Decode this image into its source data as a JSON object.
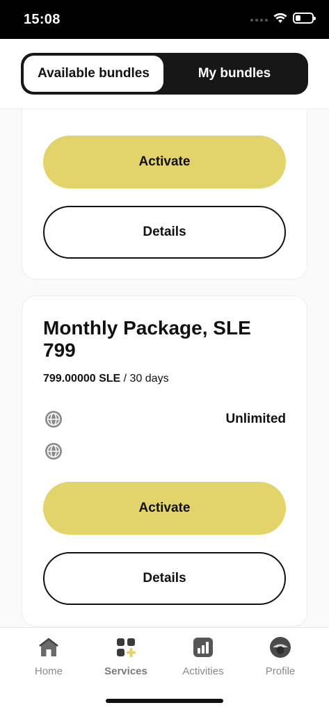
{
  "status_bar": {
    "time": "15:08"
  },
  "tabs": [
    {
      "label": "Available bundles",
      "active": true
    },
    {
      "label": "My bundles",
      "active": false
    }
  ],
  "bundles": [
    {
      "activate_label": "Activate",
      "details_label": "Details"
    },
    {
      "title": "Monthly Package, SLE 799",
      "price": "799.00000 SLE",
      "period": " / 30 days",
      "allowance_value": "Unlimited",
      "activate_label": "Activate",
      "details_label": "Details"
    }
  ],
  "bottom_nav": [
    {
      "label": "Home",
      "icon": "home-icon",
      "active": false
    },
    {
      "label": "Services",
      "icon": "services-icon",
      "active": true
    },
    {
      "label": "Activities",
      "icon": "activities-icon",
      "active": false
    },
    {
      "label": "Profile",
      "icon": "profile-icon",
      "active": false
    }
  ],
  "colors": {
    "accent": "#e2d46a",
    "dark": "#171717",
    "icon_gray": "#8a8a8a"
  }
}
